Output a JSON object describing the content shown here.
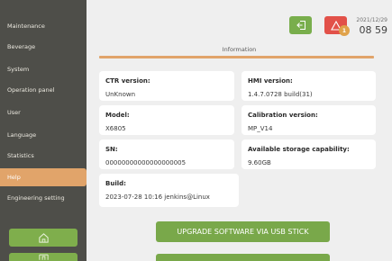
{
  "sidebar": {
    "items": [
      {
        "label": "Maintenance"
      },
      {
        "label": "Beverage"
      },
      {
        "label": "System"
      },
      {
        "label": "Operation panel"
      },
      {
        "label": "User"
      },
      {
        "label": "Language"
      },
      {
        "label": "Statistics"
      },
      {
        "label": "Help"
      },
      {
        "label": "Engineering setting"
      }
    ],
    "active_index": 7,
    "home_icon": "home-icon"
  },
  "header": {
    "date": "2021/12/29",
    "time": "08 59",
    "alarm_count": "1",
    "logout_icon": "logout-icon",
    "alarm_icon": "warning-triangle-icon"
  },
  "main": {
    "tab_title": "Information",
    "cards": {
      "ctr": {
        "label": "CTR version:",
        "value": "UnKnown"
      },
      "hmi": {
        "label": "HMI version:",
        "value": "1.4.7.0728 build(31)"
      },
      "model": {
        "label": "Model:",
        "value": "X6805"
      },
      "calibration": {
        "label": "Calibration version:",
        "value": "MP_V14"
      },
      "sn": {
        "label": "SN:",
        "value": "00000000000000000005"
      },
      "storage": {
        "label": "Available storage capability:",
        "value": "9.60GB"
      },
      "build": {
        "label": "Build:",
        "value": "2023-07-28 10:16 jenkins@Linux"
      }
    },
    "upgrade_label": "UPGRADE SOFTWARE VIA USB STICK"
  },
  "colors": {
    "sidebar_bg": "#4e4e49",
    "active_item": "#e1a46a",
    "accent_green": "#7fae4c",
    "alarm_red": "#e25149"
  }
}
